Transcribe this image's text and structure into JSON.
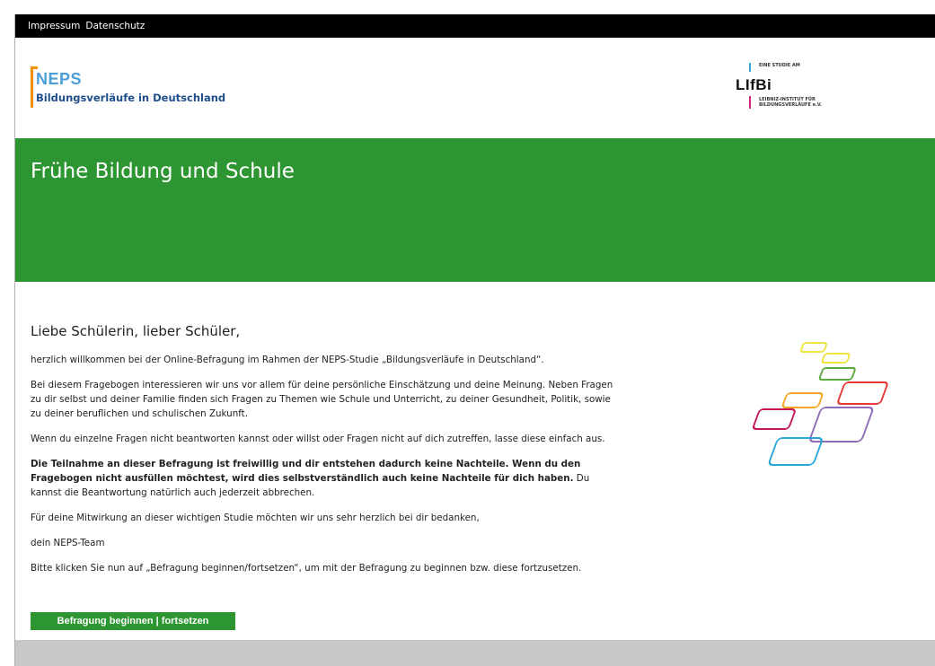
{
  "topbar": {
    "links": [
      {
        "label": "Impressum"
      },
      {
        "label": "Datenschutz"
      }
    ]
  },
  "logo_neps": {
    "word": "NEPS",
    "subtitle": "Bildungsverläufe in Deutschland"
  },
  "logo_lifbi": {
    "tagline": "EINE STUDIE AM",
    "word": "LIfBi",
    "line1": "LEIBNIZ-INSTITUT FÜR",
    "line2": "BILDUNGSVERLÄUFE e.V."
  },
  "hero": {
    "title": "Frühe Bildung und Schule"
  },
  "content": {
    "heading": "Liebe Schülerin, lieber Schüler,",
    "p1": "herzlich willkommen bei der Online-Befragung im Rahmen der NEPS-Studie „Bildungsverläufe in Deutschland“.",
    "p2": "Bei diesem Fragebogen interessieren wir uns vor allem für deine persönliche Einschätzung und deine Meinung. Neben Fragen zu dir selbst und deiner Familie finden sich Fragen zu Themen wie Schule und Unterricht, zu deiner Gesundheit, Politik, sowie zu deiner beruflichen und schulischen Zukunft.",
    "p3": "Wenn du einzelne Fragen nicht beantworten kannst oder willst oder Fragen nicht auf dich zutreffen, lasse diese einfach aus.",
    "p4_bold": "Die Teilnahme an dieser Befragung ist freiwillig und dir entstehen dadurch keine Nachteile. Wenn du den Fragebogen nicht ausfüllen möchtest, wird dies selbstverständlich auch keine Nachteile für dich haben.",
    "p4_rest": " Du kannst die Beantwortung natürlich auch jederzeit abbrechen.",
    "p5": "Für deine Mitwirkung an dieser wichtigen Studie möchten wir uns sehr herzlich bei dir bedanken,",
    "p6": "dein NEPS-Team",
    "p7": "Bitte klicken Sie nun auf „Befragung beginnen/fortsetzen“, um mit der Befragung zu beginnen bzw. diese fortzusetzen."
  },
  "cta": {
    "label": "Befragung beginnen | fortsetzen"
  },
  "colors": {
    "green": "#2d9632",
    "topbar": "#000000",
    "footer": "#c8c8c8",
    "neps_orange": "#f39200",
    "neps_blue": "#4a9fd8",
    "neps_darkblue": "#1f4e8c"
  },
  "decoration": {
    "icon": "colored-tiles-graphic",
    "tile_colors": [
      "#f0e442",
      "#f0e442",
      "#5aaa3c",
      "#e53935",
      "#f5a623",
      "#c2185b",
      "#8e6bb8",
      "#29a8d6"
    ]
  }
}
